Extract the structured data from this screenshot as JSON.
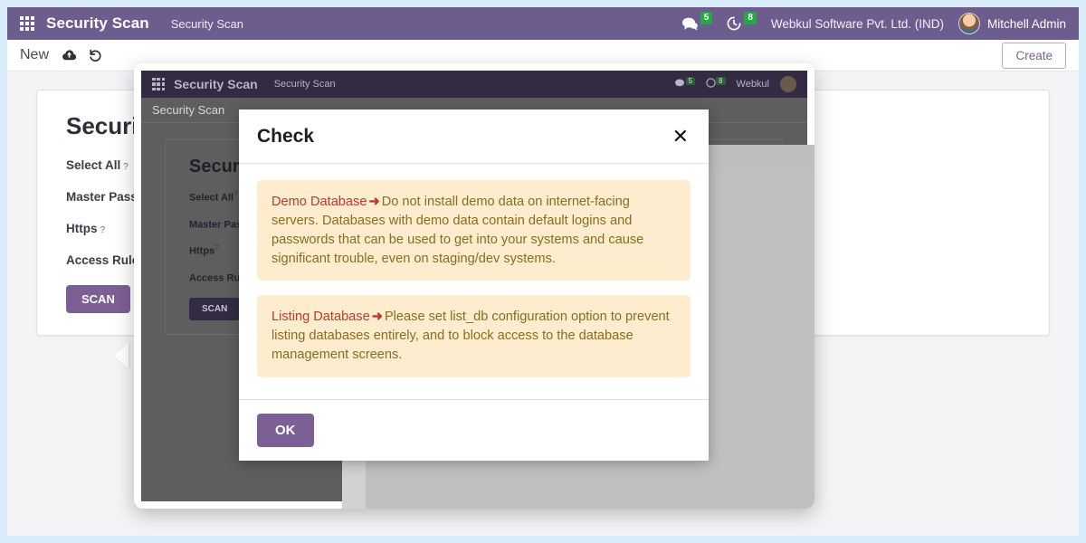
{
  "theme": {
    "navbar_bg": "#6d5d8e",
    "accent": "#7c6095",
    "badge_green": "#28a745",
    "alert_bg": "#fdecce",
    "alert_text": "#8a6d1f",
    "alert_term": "#c0392b",
    "page_border": "#d8ecfa"
  },
  "navbar": {
    "apps_icon": "apps-grid-icon",
    "brand": "Security Scan",
    "breadcrumb": "Security Scan",
    "messages": {
      "icon": "chat-bubble-icon",
      "count": "5"
    },
    "activities": {
      "icon": "clock-icon",
      "count": "8"
    },
    "company": "Webkul Software Pvt. Ltd. (IND)",
    "user": "Mitchell Admin",
    "avatar": "user-avatar"
  },
  "control_panel": {
    "new_label": "New",
    "save_icon": "cloud-upload-icon",
    "discard_icon": "undo-arrow-icon",
    "create_label": "Create"
  },
  "form": {
    "title": "Security Scan",
    "fields": [
      {
        "label": "Select All",
        "help": "?"
      },
      {
        "label": "Master Password",
        "help": "?"
      },
      {
        "label": "Https",
        "help": "?"
      },
      {
        "label": "Access Rules",
        "help": "?"
      }
    ],
    "scan_button": "SCAN"
  },
  "inner_screenshot": {
    "navbar": {
      "brand": "Security Scan",
      "breadcrumb": "Security Scan",
      "messages_count": "5",
      "activities_count": "8",
      "company": "Webkul"
    },
    "control_panel": {
      "new_label": "Security Scan"
    },
    "form": {
      "title": "Security Scan",
      "fields": [
        {
          "label": "Select All",
          "help": "?"
        },
        {
          "label": "Master Password",
          "help": "?"
        },
        {
          "label": "Https",
          "help": "?"
        },
        {
          "label": "Access Rules",
          "help": "?"
        }
      ],
      "scan_button": "SCAN"
    }
  },
  "dialog_chrome": {
    "title": "Check"
  },
  "modal": {
    "title": "Check",
    "close_icon": "close-x-icon",
    "alerts": [
      {
        "term": "Demo Database",
        "arrow": "➜",
        "text": "Do not install demo data on internet-facing servers. Databases with demo data contain default logins and passwords that can be used to get into your systems and cause significant trouble, even on staging/dev systems."
      },
      {
        "term": "Listing Database",
        "arrow": "➜",
        "text": "Please set list_db configuration option to prevent listing databases entirely, and to block access to the database management screens."
      }
    ],
    "ok_label": "OK"
  }
}
